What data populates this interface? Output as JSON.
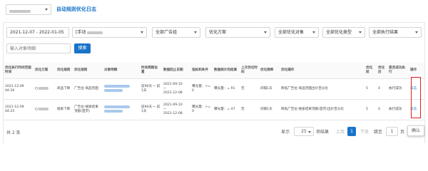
{
  "header": {
    "title": "自动规则优化日志"
  },
  "filters": {
    "date_range": "2021-12-07 - 2022-01-05",
    "plan_select": "[手动",
    "ad_group": "全部广告组",
    "optimize_plan": "优化方案",
    "optimize_object": "全部优化对象",
    "optimize_type": "全部优化类型",
    "exec_result": "全部执行结果",
    "search_placeholder": "输入对象明细",
    "search_button": "搜索"
  },
  "table": {
    "columns": [
      "优化执行时间至国时间",
      "优化方案",
      "优化规则",
      "优化规则",
      "对象明细",
      "时间周期设置",
      "数据起止日期",
      "指标和条件",
      "数据统计的结果",
      "上次优化时间",
      "优化频率",
      "优化操作",
      "优化前",
      "优化后",
      "是否成功执行",
      "操作"
    ],
    "rows": [
      {
        "time": "2021-12-09 04:30",
        "plan": "C(",
        "rule_obj": "商品下降",
        "rule_type": "广告位-商品页面",
        "period": "前90天 ~ 前1天",
        "date_from": "2021-09-10",
        "date_to": "2021-12-08",
        "condition": "曝光量：>= 0",
        "result": "曝光量：= 91",
        "last_time": "无",
        "freq": "间隔1天",
        "action": "降低广告位-商品页面出价百分比",
        "before": "5",
        "after": "4",
        "success": "执行成功",
        "op": "日志"
      },
      {
        "time": "2021-12-09 04:25",
        "plan": "C/",
        "rule_obj": "搜索下降",
        "rule_type": "广告位-搜索结果顶部(首页)",
        "period": "前90天 ~ 前1天",
        "date_from": "2021-09-10",
        "date_to": "2021-12-08",
        "condition": "曝光量：>= 0",
        "result": "曝光量：= 47",
        "last_time": "无",
        "freq": "间隔1天",
        "action": "降低广告位-搜索结果顶部(首页)出价百分比",
        "before": "5",
        "after": "4",
        "success": "执行成功",
        "op": "日志"
      }
    ]
  },
  "footer": {
    "total": "共 2 条",
    "show_label": "显示",
    "page_size": "25",
    "per_page_label": "项结果",
    "prev_label": "上页",
    "current_page": "1",
    "next_label": "下页",
    "goto_label": "跳至",
    "goto_value": "1",
    "page_suffix": "页",
    "confirm_label": "确认"
  },
  "colors": {
    "accent": "#1a73c9",
    "highlight_border": "#e0201b"
  }
}
